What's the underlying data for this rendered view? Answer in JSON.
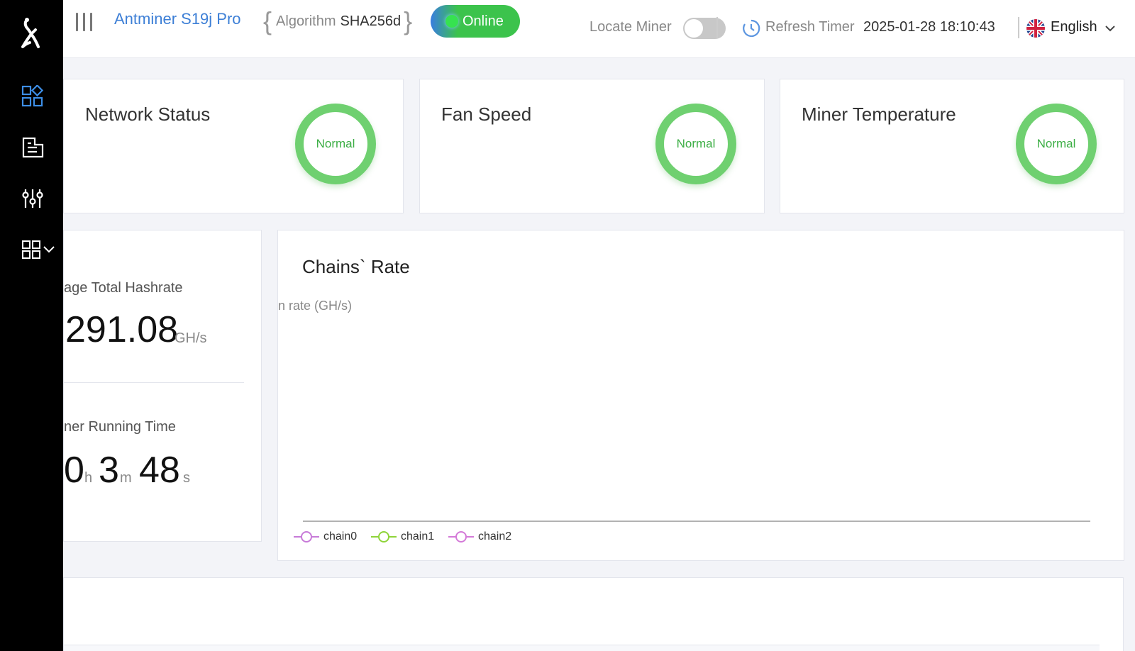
{
  "header": {
    "model": "Antminer S19j Pro",
    "algorithm_label": "Algorithm",
    "algorithm_value": "SHA256d",
    "status": "Online",
    "locate_label": "Locate Miner",
    "locate_on": false,
    "refresh_label": "Refresh Timer",
    "refresh_value": "2025-01-28 18:10:43",
    "language": "English"
  },
  "sidebar": {
    "items": [
      {
        "icon": "dashboard-icon",
        "active": true
      },
      {
        "icon": "log-icon",
        "active": false
      },
      {
        "icon": "settings-sliders-icon",
        "active": false
      },
      {
        "icon": "apps-icon",
        "active": false
      }
    ]
  },
  "status_cards": [
    {
      "title": "Network Status",
      "state": "Normal"
    },
    {
      "title": "Fan Speed",
      "state": "Normal"
    },
    {
      "title": "Miner Temperature",
      "state": "Normal"
    }
  ],
  "hashrate": {
    "label": "age Total Hashrate",
    "value": "291.08",
    "unit": "GH/s"
  },
  "runtime": {
    "label": "ner Running Time",
    "hours": "0",
    "hours_unit": "h",
    "minutes": "3",
    "minutes_unit": "m",
    "seconds": "48",
    "seconds_unit": "s"
  },
  "chart_data": {
    "type": "line",
    "title": "Chains` Rate",
    "ylabel": "n rate (GH/s)",
    "xlabel": "",
    "series": [
      {
        "name": "chain0",
        "color": "#c77ad8",
        "values": []
      },
      {
        "name": "chain1",
        "color": "#8fd43a",
        "values": []
      },
      {
        "name": "chain2",
        "color": "#d47ad8",
        "values": []
      }
    ]
  },
  "colors": {
    "accent": "#3d7fd6",
    "online": "#3cc34c",
    "normal_ring": "#6fd070"
  }
}
